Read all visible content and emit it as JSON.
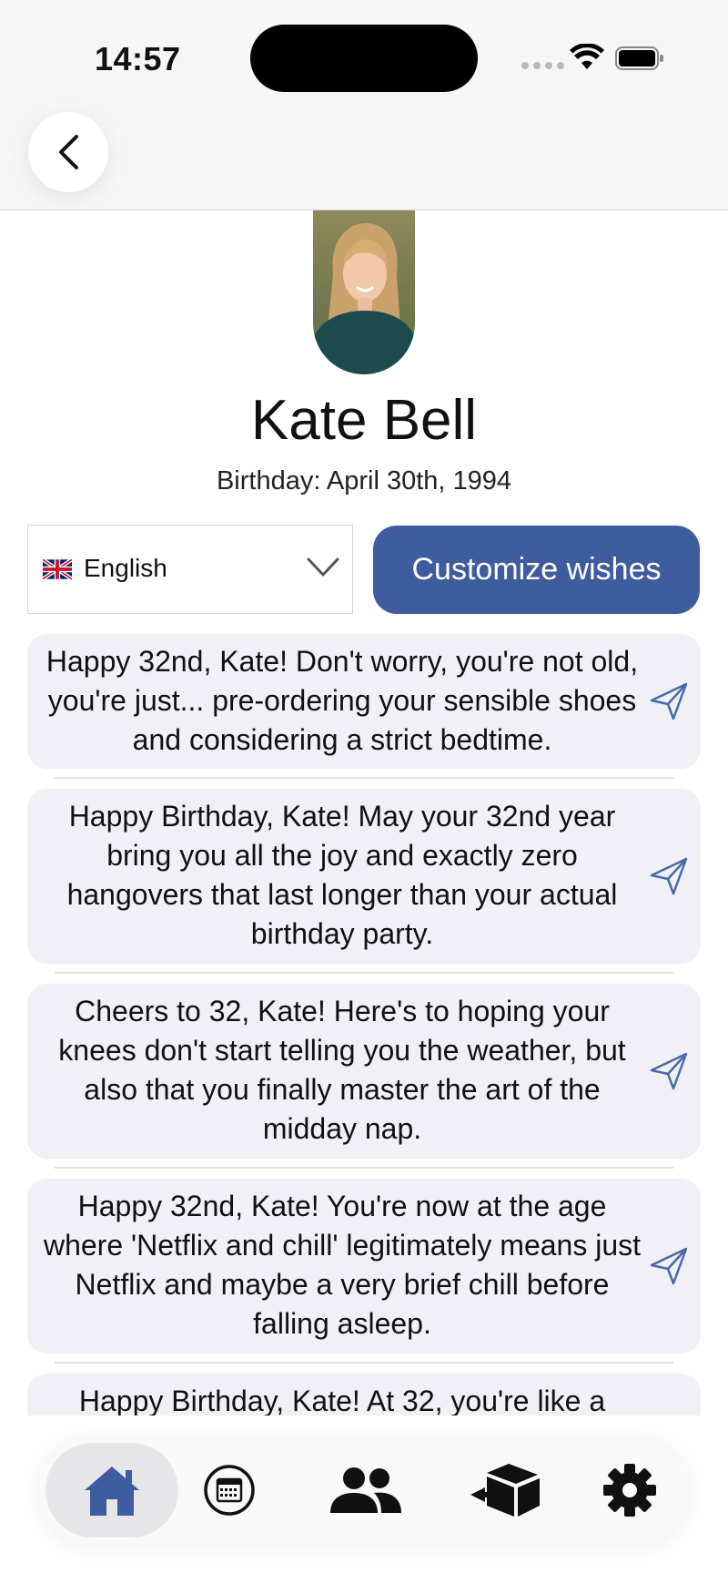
{
  "status_bar": {
    "time": "14:57"
  },
  "profile": {
    "name": "Kate Bell",
    "birthday": "Birthday: April 30th, 1994"
  },
  "language": {
    "selected": "English",
    "flag": "uk-flag"
  },
  "customize_label": "Customize wishes",
  "wishes": [
    {
      "text": "Happy 32nd, Kate! Don't worry, you're not old, you're just... pre-ordering your sensible shoes and considering a strict bedtime."
    },
    {
      "text": "Happy Birthday, Kate! May your 32nd year bring you all the joy and exactly zero hangovers that last longer than your actual birthday party."
    },
    {
      "text": "Cheers to 32, Kate! Here's to hoping your knees don't start telling you the weather, but also that you finally master the art of the midday nap."
    },
    {
      "text": "Happy 32nd, Kate! You're now at the age where 'Netflix and chill' legitimately means just Netflix and maybe a very brief chill before falling asleep."
    },
    {
      "text": "Happy Birthday, Kate! At 32, you're like a"
    }
  ],
  "tabs": [
    {
      "icon": "home-icon",
      "active": true
    },
    {
      "icon": "calendar-icon",
      "active": false
    },
    {
      "icon": "people-icon",
      "active": false
    },
    {
      "icon": "export-box-icon",
      "active": false
    },
    {
      "icon": "gear-icon",
      "active": false
    }
  ],
  "colors": {
    "accent": "#3f5c9e",
    "card_background": "#f0f0f6",
    "header_background": "#f6f6f7",
    "send_icon": "#4a6aa8"
  }
}
